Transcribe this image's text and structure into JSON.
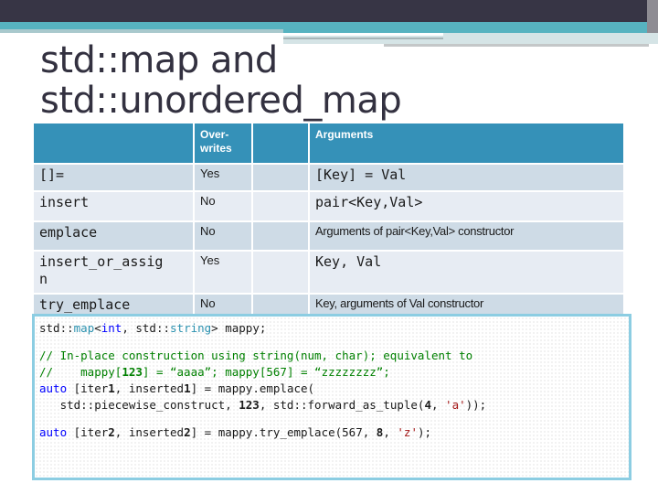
{
  "slide": {
    "title_line1": "std::map and",
    "title_line2": "std::unordered_map"
  },
  "table": {
    "headers": [
      "",
      "Over-\nwrites",
      "",
      "Arguments"
    ],
    "header_overwrites_line1": "Over-",
    "header_overwrites_line2": "writes",
    "header_arguments": "Arguments",
    "rows": [
      {
        "method": "[]=",
        "overwrites": "Yes",
        "arguments": "[Key] = Val"
      },
      {
        "method": "insert",
        "overwrites": "No",
        "arguments": "pair<Key,Val>"
      },
      {
        "method": "emplace",
        "overwrites": "No",
        "arguments": "Arguments of pair<Key,Val> constructor"
      },
      {
        "method": "insert_or_assig\nn",
        "overwrites": "Yes",
        "arguments": "Key, Val"
      },
      {
        "method": "try_emplace",
        "overwrites": "No",
        "arguments": "Key, arguments of Val constructor"
      }
    ]
  },
  "code": {
    "line1": {
      "p1": "std::",
      "p2": "map",
      "p3": "<",
      "p4": "int",
      "p5": ", std::",
      "p6": "string",
      "p7": "> mappy;"
    },
    "line2": "// In-place construction using string(num, char); equivalent to",
    "line3": {
      "p1": "//    mappy[",
      "p2": "123",
      "p3": "] = “aaaa”; mappy[",
      "p4": "567",
      "p5": "] = “zzzzzzzz”;"
    },
    "line4": {
      "p1": "auto",
      "p2": " [iter",
      "p3": "1",
      "p4": ", inserted",
      "p5": "1",
      "p6": "] = mappy.emplace("
    },
    "line5": {
      "p1": "   std::piecewise_construct, ",
      "p2": "123",
      "p3": ", std::forward_as_tuple(",
      "p4": "4",
      "p5": ", ",
      "p6": "'a'",
      "p7": "));"
    },
    "line6": {
      "p1": "auto",
      "p2": " [iter",
      "p3": "2",
      "p4": ", inserted",
      "p5": "2",
      "p6": "] = mappy.try_emplace(567, ",
      "p7": "8",
      "p8": ", ",
      "p9": "'z'",
      "p10": ");"
    }
  },
  "colors": {
    "header_bg": "#3591b8",
    "row_odd": "#cedbe6",
    "row_even": "#e7ecf3",
    "code_border": "#8ccde2",
    "top_bar": "#373545",
    "teal_band": "#57b3c0"
  }
}
